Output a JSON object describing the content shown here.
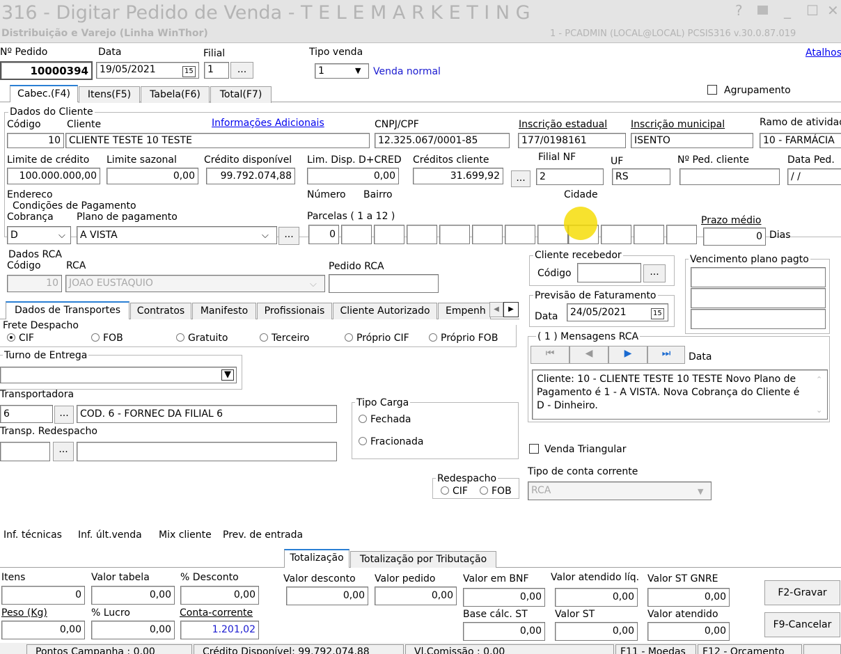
{
  "window": {
    "title": "316 - Digitar Pedido de Venda - T E L E M A R K E T I N G",
    "subtitle": "Distribuição e Varejo (Linha WinThor)",
    "user_info": "1 - PCADMIN (LOCAL@LOCAL)   PCSIS316  v.30.0.87.019",
    "help": "?",
    "min": "_",
    "max": "☐",
    "close": "✕",
    "atalhos": "Atalhos"
  },
  "header": {
    "pedido_label": "Nº Pedido",
    "pedido": "10000394",
    "data_label": "Data",
    "data": "19/05/2021",
    "filial_label": "Filial",
    "filial": "1",
    "tipo_venda_label": "Tipo venda",
    "tipo_venda": "1",
    "tipo_venda_desc": "Venda normal",
    "dots": "..."
  },
  "tabs": [
    "Cabec.(F4)",
    "Itens(F5)",
    "Tabela(F6)",
    "Total(F7)"
  ],
  "agrupamento": "Agrupamento",
  "cliente": {
    "group": "Dados do Cliente",
    "codigo_label": "Código",
    "codigo": "10",
    "cliente_label": "Cliente",
    "cliente": "CLIENTE TESTE 10 TESTE",
    "info_adic": "Informações Adicionais",
    "cnpj_label": "CNPJ/CPF",
    "cnpj": "12.325.067/0001-85",
    "ie_label": "Inscrição estadual",
    "ie": "177/0198161",
    "im_label": "Inscrição municipal",
    "im": "ISENTO",
    "ramo_label": "Ramo de atividade",
    "ramo": "10 - FARMÁCIA",
    "limite_label": "Limite de crédito",
    "limite": "100.000.000,00",
    "sazonal_label": "Limite sazonal",
    "sazonal": "0,00",
    "disp_label": "Crédito disponível",
    "disp": "99.792.074,88",
    "limdisp_label": "Lim. Disp. D+CRED",
    "limdisp": "0,00",
    "creditos_label": "Créditos cliente",
    "creditos": "31.699,92",
    "filialnf_label": "Filial NF",
    "filialnf": "2",
    "uf_label": "UF",
    "uf": "RS",
    "pedcli_label": "Nº Ped. cliente",
    "pedcli": "",
    "dataped_label": "Data Ped.",
    "dataped": "/ /",
    "endereco_label": "Endereco",
    "numero_label": "Número",
    "bairro_label": "Bairro",
    "cidade_label": "Cidade"
  },
  "pagamento": {
    "group": "Condições de Pagamento",
    "cobranca_label": "Cobrança",
    "cobranca": "D",
    "plano_label": "Plano de pagamento",
    "plano": "A VISTA",
    "parcelas_label": "Parcelas ( 1 a 12 )",
    "parcela1": "0",
    "prazo_label": "Prazo médio",
    "prazo": "0",
    "dias": "Dias"
  },
  "rca": {
    "group": "Dados RCA",
    "codigo_label": "Código",
    "codigo": "10",
    "rca_label": "RCA",
    "rca": "JOAO EUSTAQUIO",
    "pedido_label": "Pedido RCA",
    "pedido": ""
  },
  "recebedor": {
    "group": "Cliente recebedor",
    "codigo_label": "Código",
    "codigo": ""
  },
  "vencimento": {
    "group": "Vencimento plano pagto"
  },
  "previsao": {
    "group": "Previsão de Faturamento",
    "data_label": "Data",
    "data": "24/05/2021"
  },
  "mensagens": {
    "group": "( 1 ) Mensagens RCA",
    "data_label": "Data",
    "text": "Cliente: 10 - CLIENTE TESTE 10 TESTE   Novo Plano de Pagamento é  1 - A VISTA.  Nova Cobrança do Cliente é  D - Dinheiro."
  },
  "subtabs": [
    "Dados de Transportes",
    "Contratos",
    "Manifesto",
    "Profissionais",
    "Cliente Autorizado",
    "Empenh"
  ],
  "frete": {
    "group": "Frete Despacho",
    "options": [
      "CIF",
      "FOB",
      "Gratuito",
      "Terceiro",
      "Próprio CIF",
      "Próprio FOB"
    ]
  },
  "turno": {
    "group": "Turno de Entrega",
    "value": ""
  },
  "transp": {
    "label": "Transportadora",
    "codigo": "6",
    "nome": "COD. 6 - FORNEC DA FILIAL 6",
    "redesp_label": "Transp. Redespacho"
  },
  "tipocarga": {
    "group": "Tipo Carga",
    "fechada": "Fechada",
    "fracionada": "Fracionada"
  },
  "redespacho": {
    "group": "Redespacho",
    "cif": "CIF",
    "fob": "FOB"
  },
  "venda_triangular": "Venda Triangular",
  "tipo_conta": {
    "label": "Tipo de conta corrente",
    "value": "RCA"
  },
  "links": [
    "Inf. técnicas",
    "Inf. últ.venda",
    "Mix cliente",
    "Prev. de entrada"
  ],
  "bottom_tabs": [
    "Totalização",
    "Totalização por Tributação"
  ],
  "totais": {
    "itens_label": "Itens",
    "itens": "0",
    "vtabela_label": "Valor tabela",
    "vtabela": "0,00",
    "desc_label": "% Desconto",
    "desc": "0,00",
    "vdesc_label": "Valor desconto",
    "vdesc": "0,00",
    "vpedido_label": "Valor pedido",
    "vpedido": "0,00",
    "vbnf_label": "Valor em BNF",
    "vbnf": "0,00",
    "vatliq_label": "Valor atendido líq.",
    "vatliq": "0,00",
    "vst_gnre_label": "Valor ST GNRE",
    "vst_gnre": "0,00",
    "peso_label": "Peso (Kg)",
    "peso": "0,00",
    "lucro_label": "% Lucro",
    "lucro": "0,00",
    "cc_label": "Conta-corrente",
    "cc": "1.201,02",
    "bcst_label": "Base cálc. ST",
    "bcst": "0,00",
    "vst_label": "Valor ST",
    "vst": "0,00",
    "vat_label": "Valor atendido",
    "vat": "0,00"
  },
  "buttons": {
    "gravar": "F2-Gravar",
    "cancelar": "F9-Cancelar"
  },
  "status": {
    "pontos": "Pontos Campanha : 0,00",
    "credito": "Crédito Disponível: 99.792.074,88",
    "comissao": "Vl.Comissão : 0,00",
    "moedas": "F11 - Moedas",
    "orcamento": "F12 - Orçamento"
  },
  "colors": {
    "accent": "#2a7fd4",
    "link": "#0000ee",
    "blue_text": "#1a1ad0",
    "titlebar": "#e4e4e4"
  }
}
